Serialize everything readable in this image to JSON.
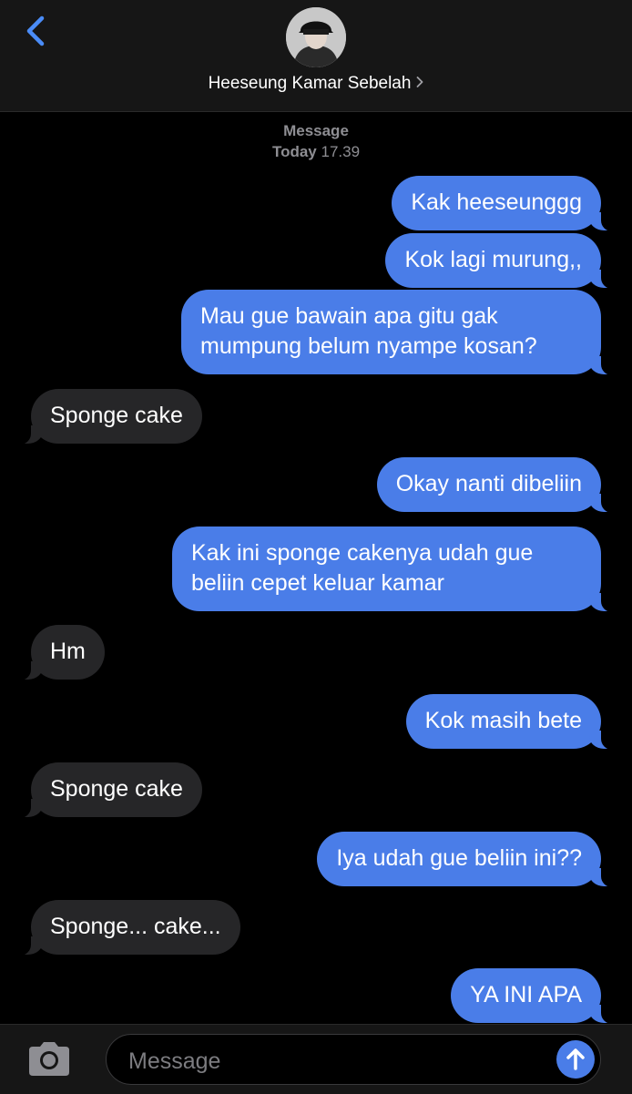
{
  "header": {
    "contact_name": "Heeseung Kamar Sebelah",
    "back_icon": "chevron-left-icon",
    "disclosure_icon": "chevron-right-icon",
    "accent": "#4a7de8"
  },
  "timestamp": {
    "service": "Message",
    "day": "Today",
    "time": "17.39"
  },
  "messages": [
    {
      "from": "me",
      "text": "Kak heeseunggg"
    },
    {
      "from": "me",
      "text": "Kok lagi murung,,"
    },
    {
      "from": "me",
      "text": "Mau gue bawain apa gitu gak mumpung belum nyampe kosan?"
    },
    {
      "from": "them",
      "text": "Sponge cake"
    },
    {
      "from": "me",
      "text": "Okay nanti dibeliin"
    },
    {
      "from": "me",
      "text": "Kak ini sponge cakenya udah gue beliin cepet keluar kamar"
    },
    {
      "from": "them",
      "text": "Hm"
    },
    {
      "from": "me",
      "text": "Kok masih bete"
    },
    {
      "from": "them",
      "text": "Sponge cake"
    },
    {
      "from": "me",
      "text": "Iya udah gue beliin ini??"
    },
    {
      "from": "them",
      "text": "Sponge... cake..."
    },
    {
      "from": "me",
      "text": "YA INI APA"
    }
  ],
  "composer": {
    "placeholder": "Message",
    "camera_icon": "camera-icon",
    "send_icon": "send-arrow-icon"
  },
  "colors": {
    "sent_bubble": "#4a7de8",
    "received_bubble": "#262628",
    "background": "#000000"
  }
}
